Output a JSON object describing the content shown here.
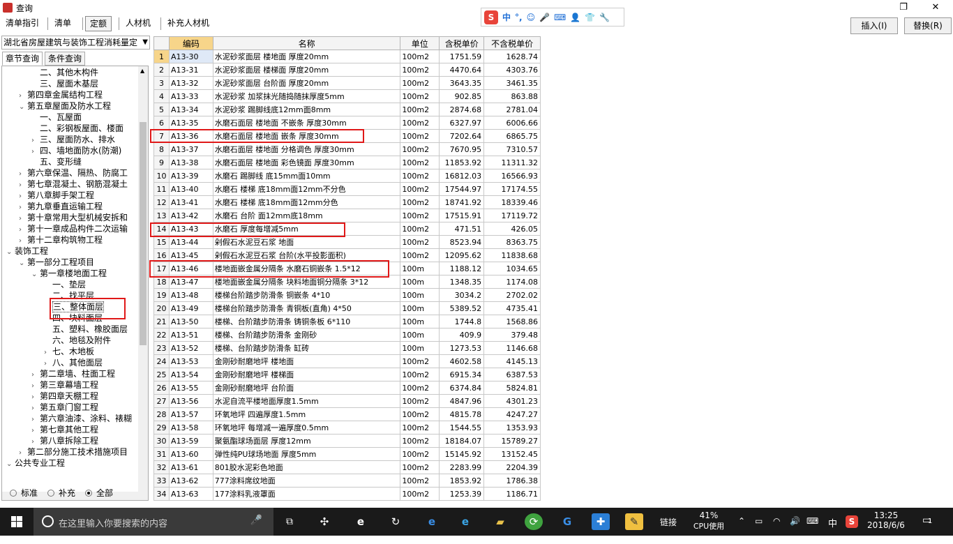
{
  "window": {
    "title": "查询"
  },
  "ime": {
    "lang": "中",
    "punct": "°,"
  },
  "toolbar": {
    "tabs": [
      {
        "label": "清单指引",
        "active": false
      },
      {
        "label": "清单",
        "active": false
      },
      {
        "label": "定额",
        "active": true
      },
      {
        "label": "人材机",
        "active": false
      },
      {
        "label": "补充人材机",
        "active": false
      }
    ],
    "insert_label": "插入(I)",
    "replace_label": "替换(R)"
  },
  "left": {
    "library": "湖北省房屋建筑与装饰工程消耗量定",
    "tab_chapter": "章节查询",
    "tab_condition": "条件查询",
    "tree": [
      {
        "label": "二、其他木构件",
        "level": 3,
        "toggle": ""
      },
      {
        "label": "三、屋面木基层",
        "level": 3,
        "toggle": ""
      },
      {
        "label": "第四章金属结构工程",
        "level": 2,
        "toggle": ">"
      },
      {
        "label": "第五章屋面及防水工程",
        "level": 2,
        "toggle": "v"
      },
      {
        "label": "一、瓦屋面",
        "level": 3,
        "toggle": ""
      },
      {
        "label": "二、彩钢板屋面、楼面",
        "level": 3,
        "toggle": ""
      },
      {
        "label": "三、屋面防水、排水",
        "level": 3,
        "toggle": ">"
      },
      {
        "label": "四、墙地面防水(防潮)",
        "level": 3,
        "toggle": ">"
      },
      {
        "label": "五、变形缝",
        "level": 3,
        "toggle": ""
      },
      {
        "label": "第六章保温、隔热、防腐工",
        "level": 2,
        "toggle": ">"
      },
      {
        "label": "第七章混凝土、钢筋混凝土",
        "level": 2,
        "toggle": ">"
      },
      {
        "label": "第八章脚手架工程",
        "level": 2,
        "toggle": ">"
      },
      {
        "label": "第九章垂直运输工程",
        "level": 2,
        "toggle": ">"
      },
      {
        "label": "第十章常用大型机械安拆和",
        "level": 2,
        "toggle": ">"
      },
      {
        "label": "第十一章成品构件二次运输",
        "level": 2,
        "toggle": ">"
      },
      {
        "label": "第十二章构筑物工程",
        "level": 2,
        "toggle": ">"
      },
      {
        "label": "装饰工程",
        "level": 1,
        "toggle": "v"
      },
      {
        "label": "第一部分工程项目",
        "level": 2,
        "toggle": "v"
      },
      {
        "label": "第一章楼地面工程",
        "level": 3,
        "toggle": "v"
      },
      {
        "label": "一、垫层",
        "level": 4,
        "toggle": ""
      },
      {
        "label": "二、找平层",
        "level": 4,
        "toggle": ""
      },
      {
        "label": "三、整体面层",
        "level": 4,
        "toggle": "",
        "selected": true
      },
      {
        "label": "四、块料面层",
        "level": 4,
        "toggle": ""
      },
      {
        "label": "五、塑料、橡胶面层",
        "level": 4,
        "toggle": ""
      },
      {
        "label": "六、地毯及附件",
        "level": 4,
        "toggle": ""
      },
      {
        "label": "七、木地板",
        "level": 4,
        "toggle": ">"
      },
      {
        "label": "八、其他面层",
        "level": 4,
        "toggle": ">"
      },
      {
        "label": "第二章墙、柱面工程",
        "level": 3,
        "toggle": ">"
      },
      {
        "label": "第三章幕墙工程",
        "level": 3,
        "toggle": ">"
      },
      {
        "label": "第四章天棚工程",
        "level": 3,
        "toggle": ">"
      },
      {
        "label": "第五章门窗工程",
        "level": 3,
        "toggle": ">"
      },
      {
        "label": "第六章油漆、涂料、裱糊",
        "level": 3,
        "toggle": ">"
      },
      {
        "label": "第七章其他工程",
        "level": 3,
        "toggle": ">"
      },
      {
        "label": "第八章拆除工程",
        "level": 3,
        "toggle": ">"
      },
      {
        "label": "第二部分施工技术措施项目",
        "level": 2,
        "toggle": ">"
      },
      {
        "label": "公共专业工程",
        "level": 1,
        "toggle": "v"
      }
    ],
    "radio": {
      "standard": "标准",
      "supplement": "补充",
      "all": "全部",
      "selected": "all"
    }
  },
  "table": {
    "headers": [
      "编码",
      "名称",
      "单位",
      "含税单价",
      "不含税单价"
    ],
    "rows": [
      [
        "1",
        "A13-30",
        "水泥砂浆面层 楼地面 厚度20mm",
        "100m2",
        "1751.59",
        "1628.74"
      ],
      [
        "2",
        "A13-31",
        "水泥砂浆面层 楼梯面 厚度20mm",
        "100m2",
        "4470.64",
        "4303.76"
      ],
      [
        "3",
        "A13-32",
        "水泥砂浆面层 台阶面 厚度20mm",
        "100m2",
        "3643.35",
        "3461.35"
      ],
      [
        "4",
        "A13-33",
        "水泥砂浆 加浆抹光随捣随抹厚度5mm",
        "100m2",
        "902.85",
        "863.88"
      ],
      [
        "5",
        "A13-34",
        "水泥砂浆 踢脚线底12mm面8mm",
        "100m2",
        "2874.68",
        "2781.04"
      ],
      [
        "6",
        "A13-35",
        "水磨石面层 楼地面 不嵌条 厚度30mm",
        "100m2",
        "6327.97",
        "6006.66"
      ],
      [
        "7",
        "A13-36",
        "水磨石面层 楼地面 嵌条 厚度30mm",
        "100m2",
        "7202.64",
        "6865.75"
      ],
      [
        "8",
        "A13-37",
        "水磨石面层 楼地面 分格调色 厚度30mm",
        "100m2",
        "7670.95",
        "7310.57"
      ],
      [
        "9",
        "A13-38",
        "水磨石面层 楼地面 彩色镜面 厚度30mm",
        "100m2",
        "11853.92",
        "11311.32"
      ],
      [
        "10",
        "A13-39",
        "水磨石 踢脚线 底15mm面10mm",
        "100m2",
        "16812.03",
        "16566.93"
      ],
      [
        "11",
        "A13-40",
        "水磨石 楼梯 底18mm面12mm不分色",
        "100m2",
        "17544.97",
        "17174.55"
      ],
      [
        "12",
        "A13-41",
        "水磨石 楼梯 底18mm面12mm分色",
        "100m2",
        "18741.92",
        "18339.46"
      ],
      [
        "13",
        "A13-42",
        "水磨石 台阶 面12mm底18mm",
        "100m2",
        "17515.91",
        "17119.72"
      ],
      [
        "14",
        "A13-43",
        "水磨石 厚度每增减5mm",
        "100m2",
        "471.51",
        "426.05"
      ],
      [
        "15",
        "A13-44",
        "剁假石水泥豆石浆 地面",
        "100m2",
        "8523.94",
        "8363.75"
      ],
      [
        "16",
        "A13-45",
        "剁假石水泥豆石浆 台阶(水平投影面积)",
        "100m2",
        "12095.62",
        "11838.68"
      ],
      [
        "17",
        "A13-46",
        "楼地面嵌金属分隔条 水磨石铜嵌条 1.5*12",
        "100m",
        "1188.12",
        "1034.65"
      ],
      [
        "18",
        "A13-47",
        "楼地面嵌金属分隔条 块料地面铜分隔条 3*12",
        "100m",
        "1348.35",
        "1174.08"
      ],
      [
        "19",
        "A13-48",
        "楼梯台阶踏步防滑条 铜嵌条 4*10",
        "100m",
        "3034.2",
        "2702.02"
      ],
      [
        "20",
        "A13-49",
        "楼梯台阶踏步防滑条 青铜板(直角) 4*50",
        "100m",
        "5389.52",
        "4735.41"
      ],
      [
        "21",
        "A13-50",
        "楼梯、台阶踏步防滑条 铸铜条板 6*110",
        "100m",
        "1744.8",
        "1568.86"
      ],
      [
        "22",
        "A13-51",
        "楼梯、台阶踏步防滑条 金刚砂",
        "100m",
        "409.9",
        "379.48"
      ],
      [
        "23",
        "A13-52",
        "楼梯、台阶踏步防滑条 缸砖",
        "100m",
        "1273.53",
        "1146.68"
      ],
      [
        "24",
        "A13-53",
        "金刚砂耐磨地坪 楼地面",
        "100m2",
        "4602.58",
        "4145.13"
      ],
      [
        "25",
        "A13-54",
        "金刚砂耐磨地坪 楼梯面",
        "100m2",
        "6915.34",
        "6387.53"
      ],
      [
        "26",
        "A13-55",
        "金刚砂耐磨地坪 台阶面",
        "100m2",
        "6374.84",
        "5824.81"
      ],
      [
        "27",
        "A13-56",
        "水泥自流平楼地面厚度1.5mm",
        "100m2",
        "4847.96",
        "4301.23"
      ],
      [
        "28",
        "A13-57",
        "环氧地坪 四遍厚度1.5mm",
        "100m2",
        "4815.78",
        "4247.27"
      ],
      [
        "29",
        "A13-58",
        "环氧地坪 每增减一遍厚度0.5mm",
        "100m2",
        "1544.55",
        "1353.93"
      ],
      [
        "30",
        "A13-59",
        "聚氨酯球场面层 厚度12mm",
        "100m2",
        "18184.07",
        "15789.27"
      ],
      [
        "31",
        "A13-60",
        "弹性纯PU球场地面 厚度5mm",
        "100m2",
        "15145.92",
        "13152.45"
      ],
      [
        "32",
        "A13-61",
        "801胶水泥彩色地面",
        "100m2",
        "2283.99",
        "2204.39"
      ],
      [
        "33",
        "A13-62",
        "777涂料席纹地面",
        "100m2",
        "1853.92",
        "1786.38"
      ],
      [
        "34",
        "A13-63",
        "177涂料乳液罩面",
        "100m2",
        "1253.39",
        "1186.71"
      ]
    ]
  },
  "taskbar": {
    "search_placeholder": "在这里输入你要搜索的内容",
    "link_label": "链接",
    "cpu_percent": "41%",
    "cpu_label": "CPU使用",
    "ime_lang": "中",
    "time": "13:25",
    "date": "2018/6/6",
    "notification_count": "1"
  },
  "colors": {
    "highlight_red": "#e01818",
    "selected_header": "#f7d58a"
  }
}
